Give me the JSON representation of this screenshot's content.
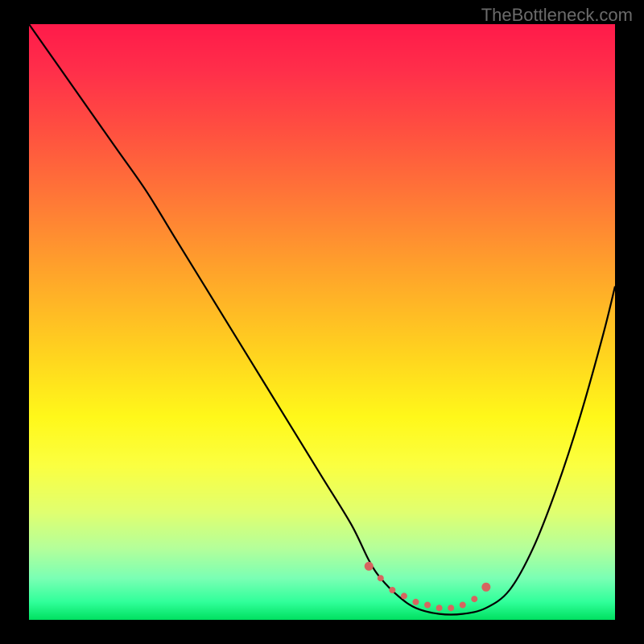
{
  "watermark": "TheBottleneck.com",
  "chart_data": {
    "type": "line",
    "title": "",
    "xlabel": "",
    "ylabel": "",
    "xlim": [
      0,
      100
    ],
    "ylim": [
      0,
      100
    ],
    "grid": false,
    "series": [
      {
        "name": "bottleneck-curve",
        "x": [
          0,
          5,
          10,
          15,
          20,
          25,
          30,
          35,
          40,
          45,
          50,
          55,
          58,
          60,
          63,
          66,
          70,
          74,
          78,
          82,
          86,
          90,
          94,
          98,
          100
        ],
        "y": [
          100,
          93,
          86,
          79,
          72,
          64,
          56,
          48,
          40,
          32,
          24,
          16,
          10,
          7,
          4,
          2,
          1,
          1,
          2,
          5,
          12,
          22,
          34,
          48,
          56
        ]
      }
    ],
    "highlight_points": {
      "name": "valley-points",
      "x": [
        58,
        60,
        62,
        64,
        66,
        68,
        70,
        72,
        74,
        76,
        78
      ],
      "y": [
        9,
        7,
        5,
        4,
        3,
        2.5,
        2,
        2,
        2.5,
        3.5,
        5.5
      ]
    },
    "background_gradient": {
      "top": "#ff1a4a",
      "mid": "#fff81a",
      "bottom": "#00e060"
    }
  }
}
